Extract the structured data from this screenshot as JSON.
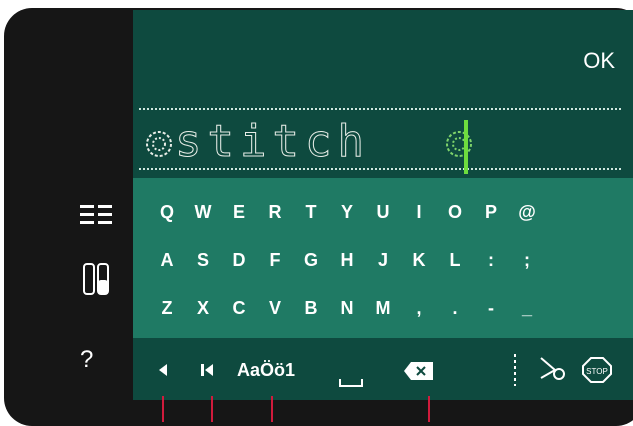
{
  "header": {
    "ok_label": "OK"
  },
  "text_area": {
    "value": "stitch",
    "cursor_visible": true
  },
  "keyboard": {
    "rows": [
      [
        "Q",
        "W",
        "E",
        "R",
        "T",
        "Y",
        "U",
        "I",
        "O",
        "P",
        "@"
      ],
      [
        "A",
        "S",
        "D",
        "F",
        "G",
        "H",
        "J",
        "K",
        "L",
        ":",
        ";"
      ],
      [
        "Z",
        "X",
        "C",
        "V",
        "B",
        "N",
        "M",
        ",",
        ".",
        "-",
        "_"
      ]
    ]
  },
  "toolbar": {
    "case_label": "AaÖö1"
  },
  "sidebar": {
    "icons": [
      "menu-icon",
      "tools-icon",
      "help-icon"
    ]
  },
  "colors": {
    "screen_bg": "#0e4a3f",
    "keyboard_bg": "#1f7a64",
    "accent": "#6edc3e",
    "callout": "#d11b3c"
  }
}
